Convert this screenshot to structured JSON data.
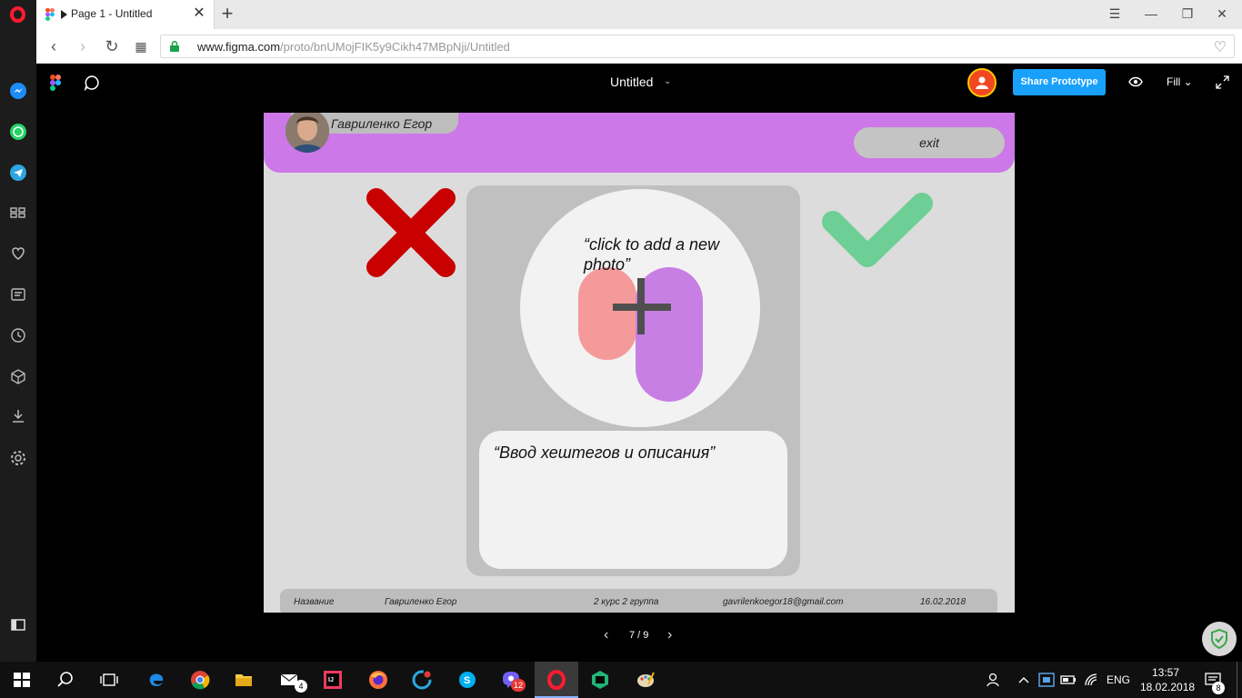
{
  "browser": {
    "tab_title": "Page 1 - Untitled",
    "url_host": "www.figma.com",
    "url_path": "/proto/bnUMojFIK5y9Cikh47MBpNji/Untitled"
  },
  "figma": {
    "file_title": "Untitled",
    "share_label": "Share Prototype",
    "fill_label": "Fill"
  },
  "proto": {
    "user_name": "Гавриленко Егор",
    "exit_label": "exit",
    "photo_placeholder": "“click to add a new photo”",
    "description_placeholder": "“Ввод хештегов и  описания”",
    "footer": {
      "label": "Название",
      "author": "Гавриленко Егор",
      "group": "2 курс 2 группа",
      "email": "gavrilenkoegor18@gmail.com",
      "date": "16.02.2018"
    },
    "colors": {
      "header": "#cc78e8",
      "reject": "#c80000",
      "accept": "#6dcf95",
      "plus_left": "#f59a9a",
      "plus_right": "#c77fe3"
    }
  },
  "pager": {
    "current": "7",
    "total": "9",
    "text": "7 / 9"
  },
  "taskbar": {
    "mail_badge": "4",
    "viber_badge": "12",
    "notif_badge": "8",
    "lang": "ENG",
    "time": "13:57",
    "date": "18.02.2018"
  }
}
